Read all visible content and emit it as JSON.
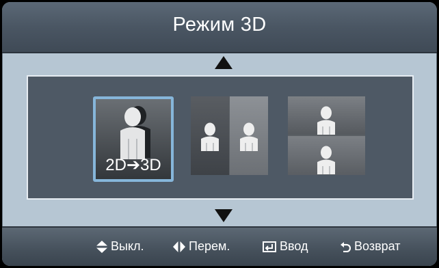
{
  "title": "Режим 3D",
  "modes": [
    {
      "id": "2d-to-3d",
      "label": "2D➔3D",
      "selected": true
    },
    {
      "id": "side-by-side",
      "label": "",
      "selected": false
    },
    {
      "id": "top-bottom",
      "label": "",
      "selected": false
    }
  ],
  "footer": {
    "hints": [
      {
        "icon": "up-down-arrows-icon",
        "label": "Выкл."
      },
      {
        "icon": "left-right-arrows-icon",
        "label": "Перем."
      },
      {
        "icon": "enter-icon",
        "label": "Ввод"
      },
      {
        "icon": "return-icon",
        "label": "Возврат"
      }
    ]
  },
  "colors": {
    "header": "#4a5663",
    "body": "#b6c6d3",
    "panel": "#4e5965",
    "selection": "#86b6da"
  }
}
